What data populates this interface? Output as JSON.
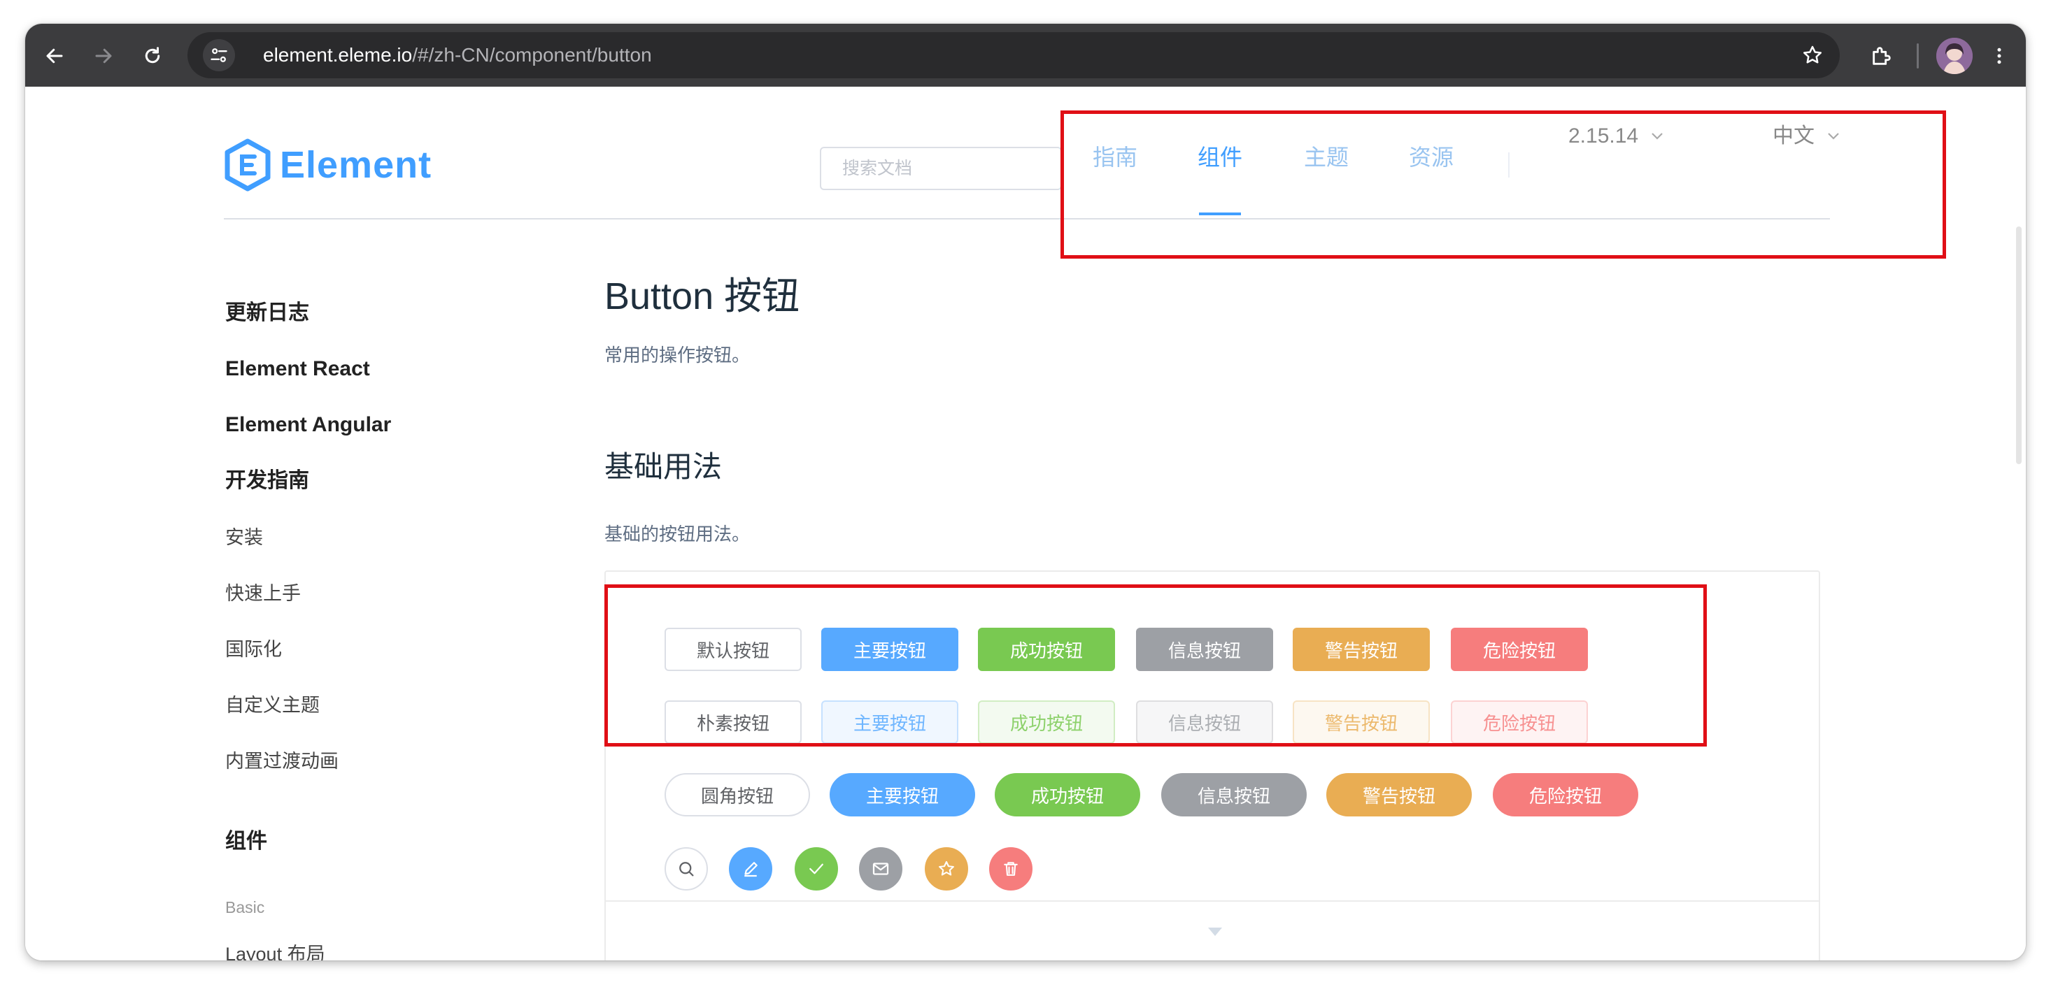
{
  "browser": {
    "url_host": "element.eleme.io",
    "url_path": "/#/zh-CN/component/button",
    "back_icon": "arrow-left-icon",
    "forward_icon": "arrow-right-icon",
    "reload_icon": "reload-icon",
    "site_info_icon": "tune-icon",
    "bookmark_icon": "star-outline-icon",
    "extensions_icon": "puzzle-icon",
    "menu_icon": "kebab-menu-icon"
  },
  "header": {
    "logo_text": "Element",
    "search_placeholder": "搜索文档",
    "nav": [
      {
        "label": "指南",
        "active": false
      },
      {
        "label": "组件",
        "active": true
      },
      {
        "label": "主题",
        "active": false
      },
      {
        "label": "资源",
        "active": false
      }
    ],
    "version": "2.15.14",
    "language": "中文"
  },
  "sidebar": {
    "items": [
      {
        "label": "更新日志",
        "style": "bold"
      },
      {
        "label": "Element React",
        "style": "bold"
      },
      {
        "label": "Element Angular",
        "style": "bold"
      },
      {
        "label": "开发指南",
        "style": "bold"
      },
      {
        "label": "安装",
        "style": "item"
      },
      {
        "label": "快速上手",
        "style": "item"
      },
      {
        "label": "国际化",
        "style": "item"
      },
      {
        "label": "自定义主题",
        "style": "item"
      },
      {
        "label": "内置过渡动画",
        "style": "item"
      },
      {
        "label": "组件",
        "style": "bold"
      },
      {
        "label": "Basic",
        "style": "sub"
      },
      {
        "label": "Layout 布局",
        "style": "item"
      }
    ]
  },
  "main": {
    "title": "Button 按钮",
    "description": "常用的操作按钮。",
    "section_title": "基础用法",
    "section_description": "基础的按钮用法。"
  },
  "demo": {
    "row_default": [
      "默认按钮",
      "主要按钮",
      "成功按钮",
      "信息按钮",
      "警告按钮",
      "危险按钮"
    ],
    "row_plain": [
      "朴素按钮",
      "主要按钮",
      "成功按钮",
      "信息按钮",
      "警告按钮",
      "危险按钮"
    ],
    "row_round": [
      "圆角按钮",
      "主要按钮",
      "成功按钮",
      "信息按钮",
      "警告按钮",
      "危险按钮"
    ],
    "row_circle_icons": [
      "search-icon",
      "edit-icon",
      "check-icon",
      "message-icon",
      "star-icon",
      "delete-icon"
    ],
    "expand_icon": "caret-down-icon"
  },
  "colors": {
    "primary": "#409eff",
    "success": "#67c23a",
    "info": "#909399",
    "warning": "#e6a23c",
    "danger": "#f56c6c",
    "highlight_box": "#e00f16"
  }
}
